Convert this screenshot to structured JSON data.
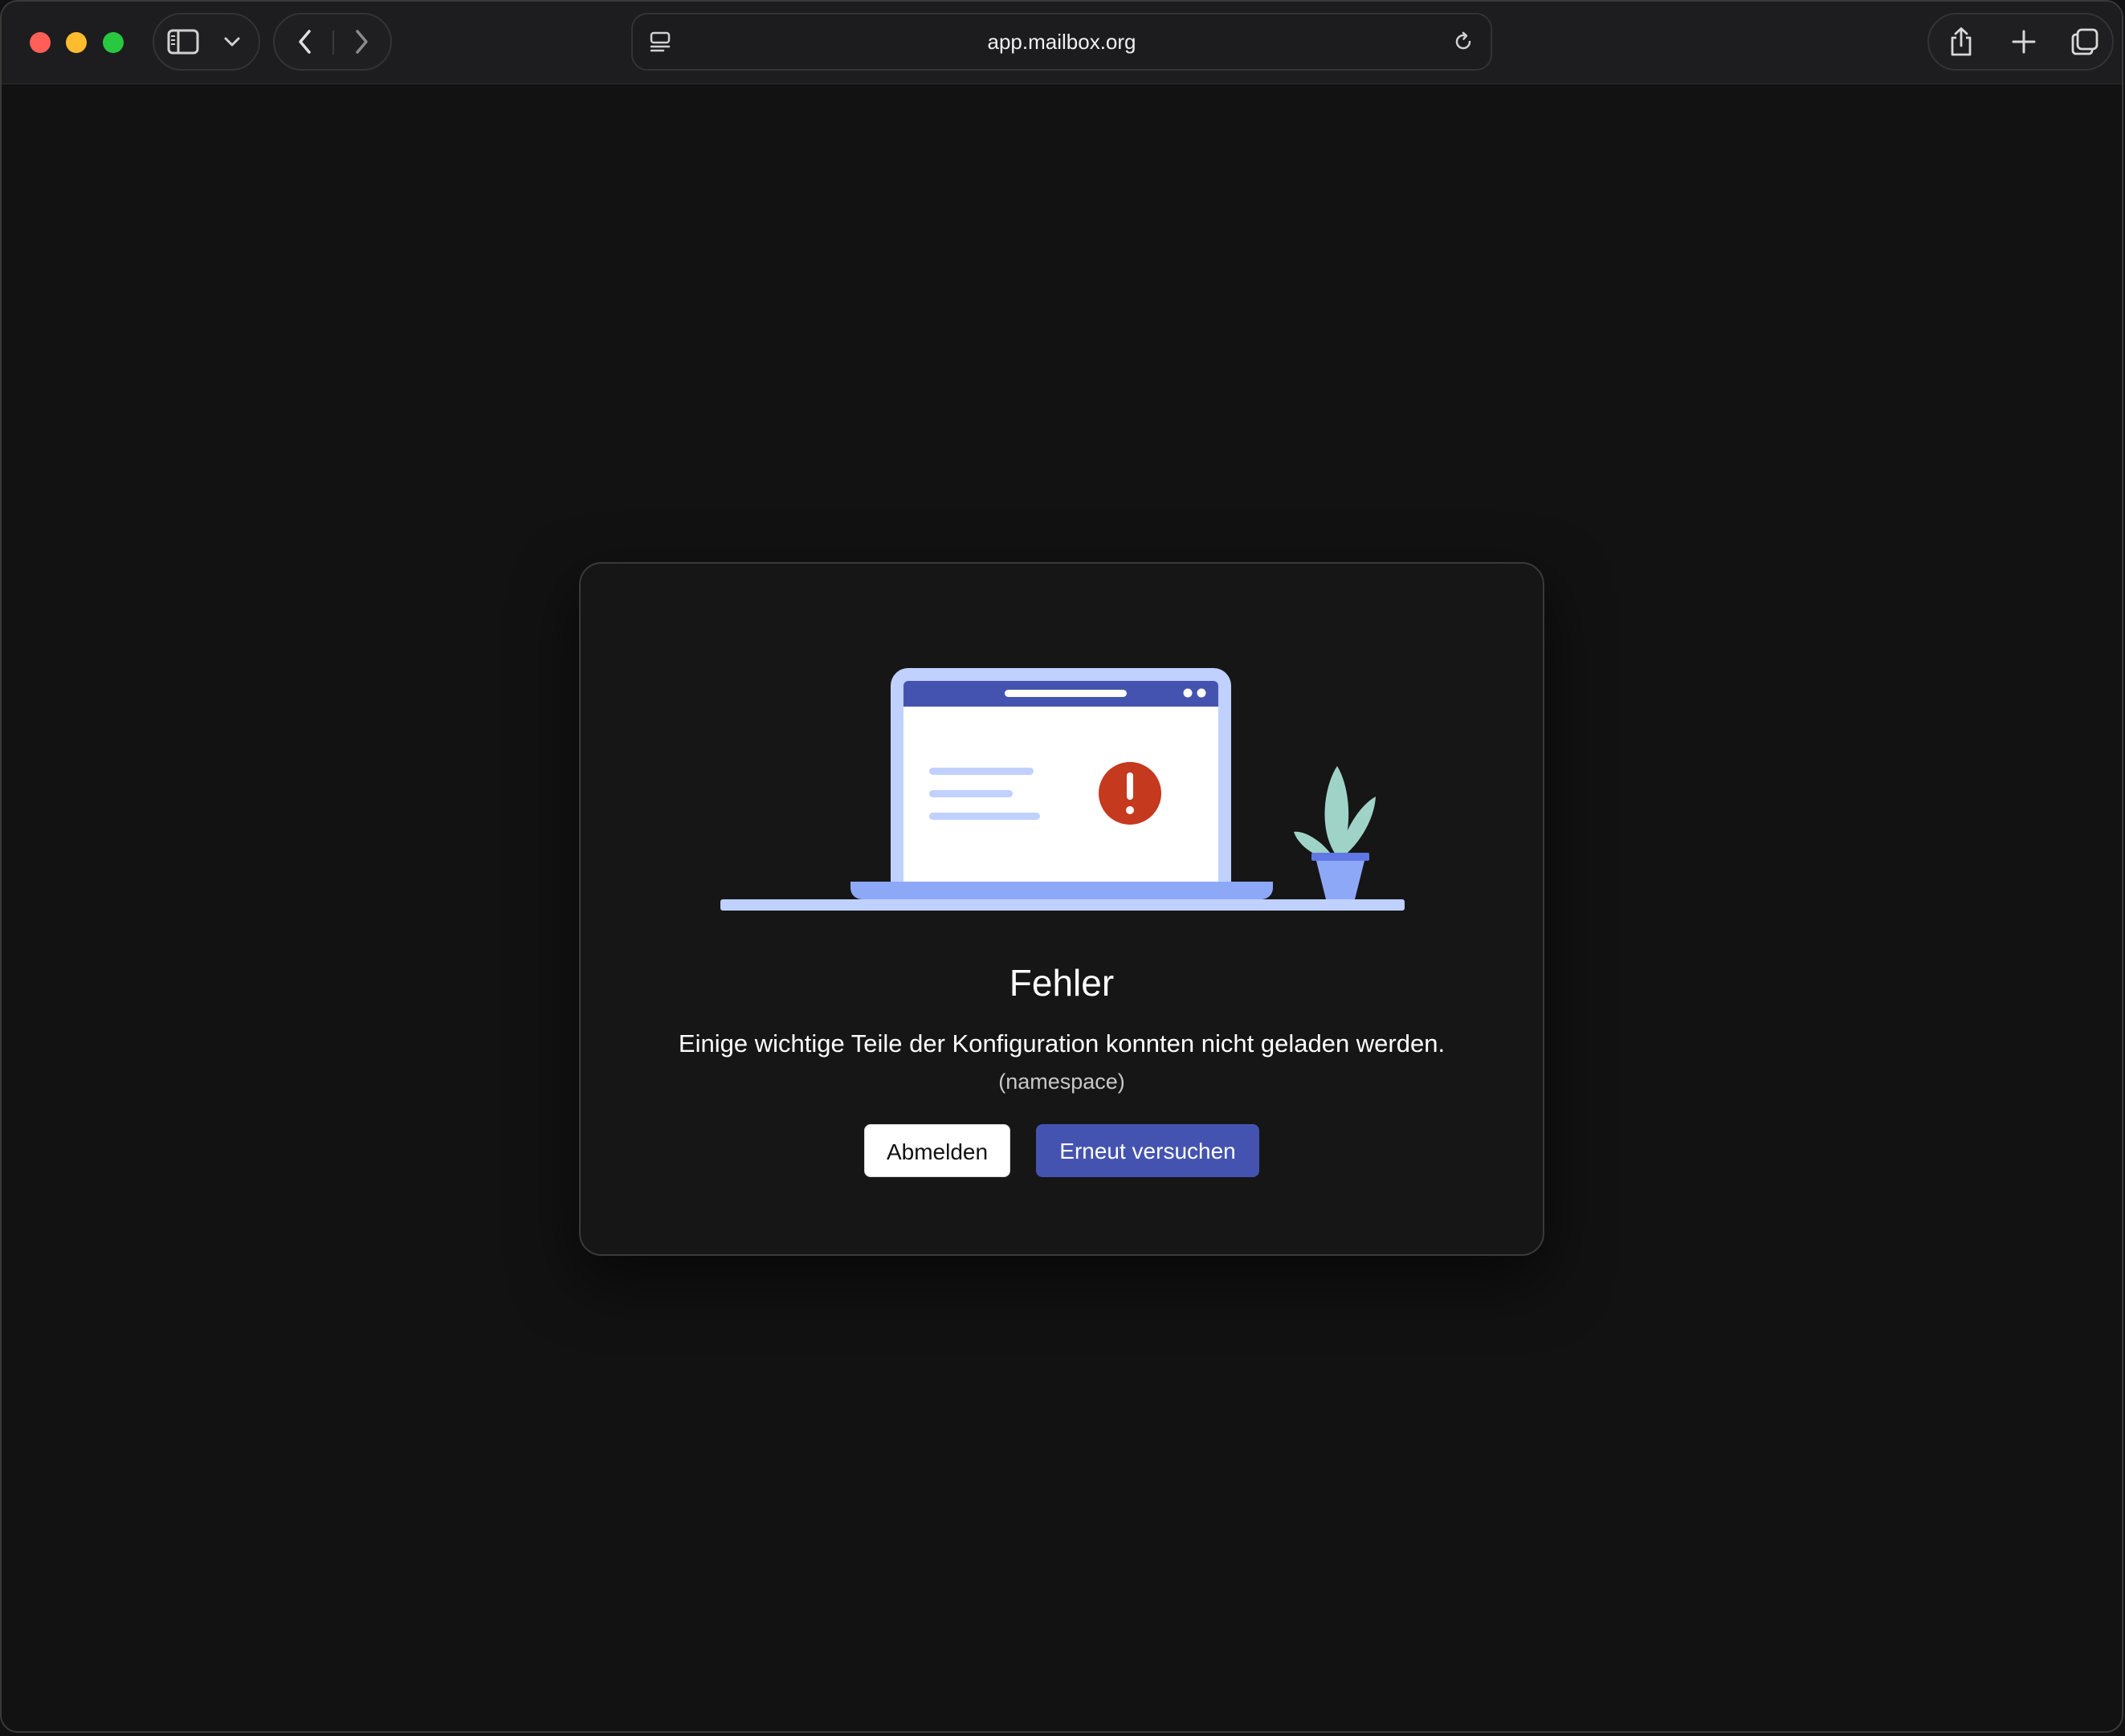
{
  "browser": {
    "url": "app.mailbox.org"
  },
  "colors": {
    "accent": "#4553b0",
    "error": "#c5391f",
    "laptop_frame": "#c0d0ff",
    "plant": "#9fd3c7"
  },
  "icons": {
    "sidebar": "sidebar-icon",
    "chevron": "chevron-down-icon",
    "back": "chevron-left-icon",
    "forward": "chevron-right-icon",
    "page_settings": "page-settings-icon",
    "reload": "reload-icon",
    "share": "share-icon",
    "new_tab": "plus-icon",
    "tabs": "tab-overview-icon"
  },
  "dialog": {
    "title": "Fehler",
    "message": "Einige wichtige Teile der Konfiguration konnten nicht geladen werden.",
    "detail": "(namespace)",
    "logout_label": "Abmelden",
    "retry_label": "Erneut versuchen"
  }
}
